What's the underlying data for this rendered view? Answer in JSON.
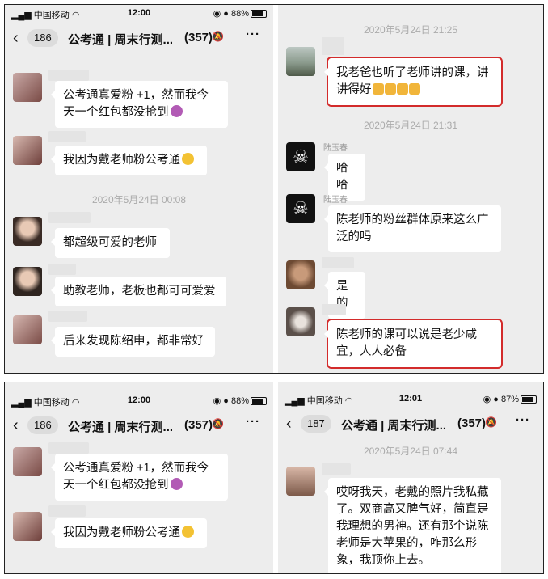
{
  "colors": {
    "highlight": "#d32b2b",
    "panel_bg": "#ededed"
  },
  "panels": [
    {
      "status": {
        "carrier": "中国移动",
        "time": "12:00",
        "battery": "88%"
      },
      "header": {
        "back_count": "186",
        "title": "公考通 | 周末行测...",
        "members": "(357)"
      },
      "time1": "2020年5月24日 00:08",
      "messages": [
        {
          "text": "公考通真爱粉 +1，然而我今天一个红包都没抢到"
        },
        {
          "text": "我因为戴老师粉公考通"
        },
        {
          "text": "都超级可爱的老师"
        },
        {
          "text": "助教老师，老板也都可可爱爱"
        },
        {
          "text": "后来发现陈绍申，都非常好"
        }
      ]
    },
    {
      "time1": "2020年5月24日 21:25",
      "time2": "2020年5月24日 21:31",
      "messages": [
        {
          "text": "我老爸也听了老师讲的课，讲讲得好"
        },
        {
          "sender": "陆玉春",
          "text": "哈哈"
        },
        {
          "sender": "陆玉春",
          "text": "陈老师的粉丝群体原来这么广泛的吗"
        },
        {
          "text": "是的"
        },
        {
          "text": "陈老师的课可以说是老少咸宜，人人必备"
        }
      ]
    },
    {
      "status": {
        "carrier": "中国移动",
        "time": "12:00",
        "battery": "88%"
      },
      "header": {
        "back_count": "186",
        "title": "公考通 | 周末行测...",
        "members": "(357)"
      },
      "messages": [
        {
          "text": "公考通真爱粉 +1，然而我今天一个红包都没抢到"
        },
        {
          "text": "我因为戴老师粉公考通"
        }
      ]
    },
    {
      "status": {
        "carrier": "中国移动",
        "time": "12:01",
        "battery": "87%"
      },
      "header": {
        "back_count": "187",
        "title": "公考通 | 周末行测...",
        "members": "(357)"
      },
      "time1": "2020年5月24日 07:44",
      "messages": [
        {
          "text": "哎呀我天，老戴的照片我私藏了。双商高又脾气好，简直是我理想的男神。还有那个说陈老师是大苹果的，咋那么形象，我顶你上去。"
        }
      ]
    }
  ]
}
